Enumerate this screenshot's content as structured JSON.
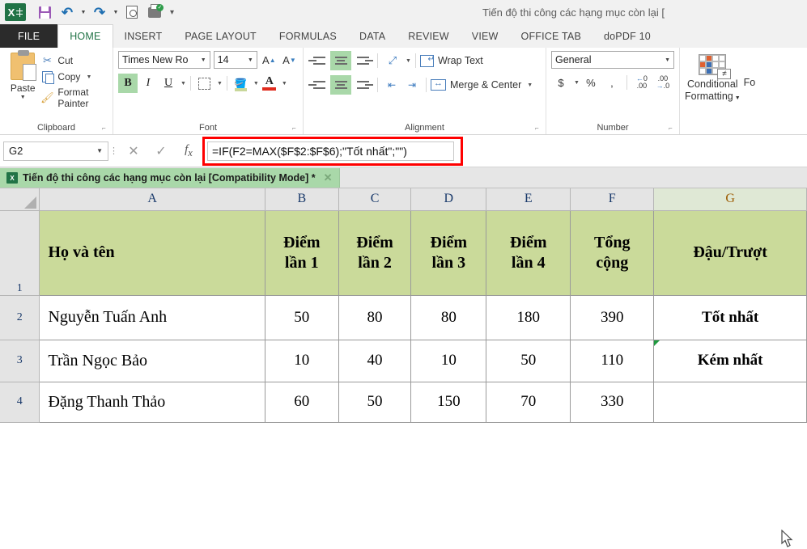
{
  "window": {
    "title": "Tiến độ thi công các hạng mục còn lại  [",
    "app_logo": "excel-logo"
  },
  "quick_access": {
    "items": [
      {
        "name": "save",
        "icon": "save-icon"
      },
      {
        "name": "undo",
        "icon": "undo-arrow-icon"
      },
      {
        "name": "redo",
        "icon": "redo-arrow-icon"
      },
      {
        "name": "print-preview",
        "icon": "print-preview-icon"
      },
      {
        "name": "quick-print",
        "icon": "printer-icon"
      },
      {
        "name": "customize",
        "icon": "chevron-down-icon"
      }
    ]
  },
  "ribbon": {
    "tabs": [
      {
        "label": "FILE",
        "active": false
      },
      {
        "label": "HOME",
        "active": true
      },
      {
        "label": "INSERT",
        "active": false
      },
      {
        "label": "PAGE LAYOUT",
        "active": false
      },
      {
        "label": "FORMULAS",
        "active": false
      },
      {
        "label": "DATA",
        "active": false
      },
      {
        "label": "REVIEW",
        "active": false
      },
      {
        "label": "VIEW",
        "active": false
      },
      {
        "label": "OFFICE TAB",
        "active": false
      },
      {
        "label": "doPDF 10",
        "active": false
      }
    ],
    "clipboard": {
      "group_label": "Clipboard",
      "paste": "Paste",
      "cut": "Cut",
      "copy": "Copy",
      "format_painter": "Format Painter"
    },
    "font": {
      "group_label": "Font",
      "font_name": "Times New Ro",
      "font_size": "14",
      "bold": "B",
      "italic": "I",
      "underline": "U",
      "font_color_accent": "#e02b1d",
      "fill_color_accent": "#c8d79a",
      "bold_active": true
    },
    "alignment": {
      "group_label": "Alignment",
      "wrap_text": "Wrap Text",
      "merge_center": "Merge & Center",
      "v_align_active": "middle",
      "h_align_active": "center"
    },
    "number": {
      "group_label": "Number",
      "format": "General",
      "currency": "$",
      "percent": "%",
      "comma": ","
    },
    "styles": {
      "conditional_formatting_line1": "Conditional",
      "conditional_formatting_line2": "Formatting",
      "truncated_next": "Fo"
    }
  },
  "formula_bar": {
    "name_box": "G2",
    "cancel_icon": "close-icon",
    "enter_icon": "check-icon",
    "function_icon": "fx-icon",
    "formula": "=IF(F2=MAX($F$2:$F$6);\"Tốt nhất\";\"\")",
    "highlight_color": "#ff0000"
  },
  "document_tab": {
    "label": "Tiến độ thi công các hạng mục còn lại  [Compatibility Mode] *",
    "close": "✕"
  },
  "sheet": {
    "column_headers": [
      "A",
      "B",
      "C",
      "D",
      "E",
      "F",
      "G"
    ],
    "selected_column": "G",
    "row_headers": [
      "1",
      "2",
      "3",
      "4"
    ],
    "header_row": [
      "Họ và tên",
      "Điểm\nlần 1",
      "Điểm\nlần 2",
      "Điểm\nlần 3",
      "Điểm\nlần 4",
      "Tổng\ncộng",
      "Đậu/Trượt"
    ],
    "header_row_parts": {
      "a": "Họ và tên",
      "b1": "Điểm",
      "b2": "lần 1",
      "c1": "Điểm",
      "c2": "lần 2",
      "d1": "Điểm",
      "d2": "lần 3",
      "e1": "Điểm",
      "e2": "lần 4",
      "f1": "Tổng",
      "f2": "cộng",
      "g": "Đậu/Trượt"
    },
    "rows": [
      {
        "row": "2",
        "name": "Nguyễn Tuấn Anh",
        "diem1": "50",
        "diem2": "80",
        "diem3": "80",
        "diem4": "180",
        "tong": "390",
        "ketqua": "Tốt nhất"
      },
      {
        "row": "3",
        "name": "Trần Ngọc Bảo",
        "diem1": "10",
        "diem2": "40",
        "diem3": "10",
        "diem4": "50",
        "tong": "110",
        "ketqua": "Kém nhất"
      },
      {
        "row": "4",
        "name": "Đặng Thanh Thảo",
        "diem1": "60",
        "diem2": "50",
        "diem3": "150",
        "diem4": "70",
        "tong": "330",
        "ketqua": ""
      }
    ],
    "header_fill": "#cada9a"
  }
}
